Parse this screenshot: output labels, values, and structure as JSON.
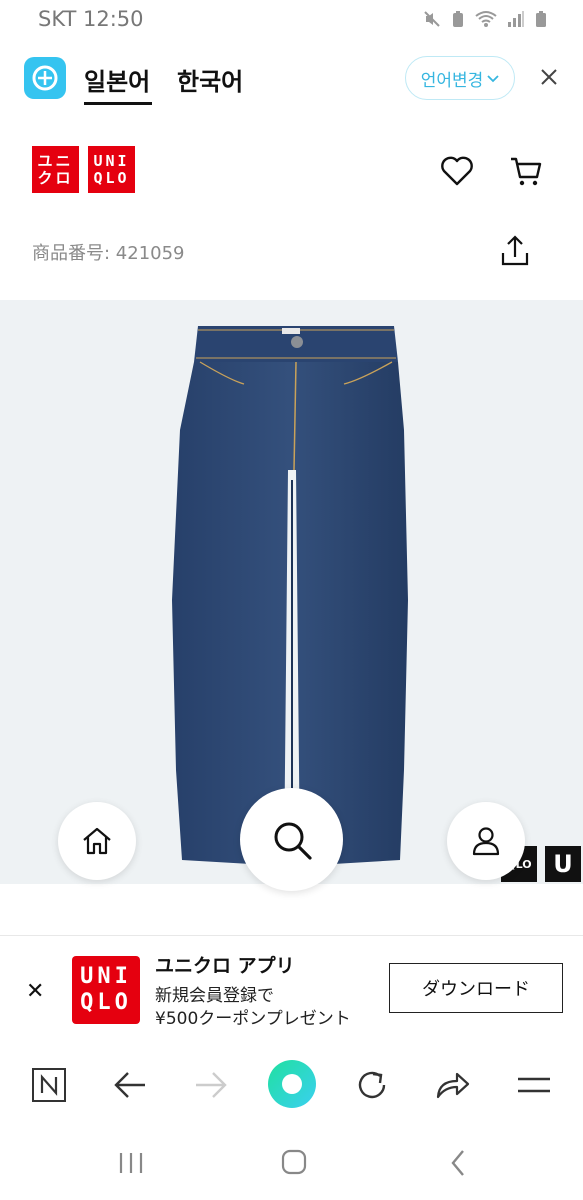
{
  "status": {
    "carrier_time": "SKT 12:50"
  },
  "translate_bar": {
    "tab_japanese": "일본어",
    "tab_korean": "한국어",
    "change_language": "언어변경"
  },
  "header": {
    "logo_text_katakana": [
      "ユニ",
      "クロ"
    ],
    "logo_text_latin": [
      "UNI",
      "QLO"
    ],
    "product_number": "商品番号: 421059"
  },
  "watermark": {
    "letter": "U"
  },
  "app_banner": {
    "title": "ユニクロ アプリ",
    "line1": "新規会員登録で",
    "line2": "¥500クーポンプレゼント",
    "download": "ダウンロード",
    "logo_text": [
      "UNI",
      "QLO"
    ]
  },
  "icons": {
    "heart": "heart-icon",
    "cart": "cart-icon",
    "share": "share-icon",
    "home": "home-icon",
    "search": "search-icon",
    "account": "user-icon"
  },
  "colors": {
    "brand_red": "#e5000f",
    "accent_blue": "#36b6e0",
    "denim": "#2f4a72"
  }
}
